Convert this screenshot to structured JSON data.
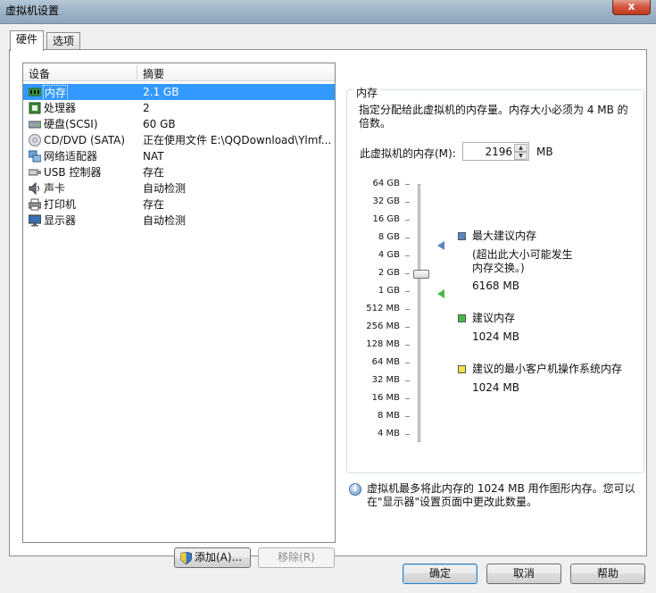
{
  "window": {
    "title": "虚拟机设置",
    "close_label": "x"
  },
  "tabs": [
    {
      "label": "硬件",
      "active": true
    },
    {
      "label": "选项",
      "active": false
    }
  ],
  "device_list": {
    "headers": {
      "device": "设备",
      "summary": "摘要"
    },
    "rows": [
      {
        "icon": "memory-icon",
        "name": "内存",
        "summary": "2.1 GB",
        "selected": true
      },
      {
        "icon": "processor-icon",
        "name": "处理器",
        "summary": "2"
      },
      {
        "icon": "hard-disk-icon",
        "name": "硬盘(SCSI)",
        "summary": "60 GB"
      },
      {
        "icon": "cd-dvd-icon",
        "name": "CD/DVD (SATA)",
        "summary": "正在使用文件 E:\\QQDownload\\Ylmf..."
      },
      {
        "icon": "network-adapter-icon",
        "name": "网络适配器",
        "summary": "NAT"
      },
      {
        "icon": "usb-icon",
        "name": "USB 控制器",
        "summary": "存在"
      },
      {
        "icon": "sound-card-icon",
        "name": "声卡",
        "summary": "自动检测"
      },
      {
        "icon": "printer-icon",
        "name": "打印机",
        "summary": "存在"
      },
      {
        "icon": "display-icon",
        "name": "显示器",
        "summary": "自动检测"
      }
    ],
    "add_button": "添加(A)...",
    "remove_button": "移除(R)"
  },
  "memory": {
    "group_title": "内存",
    "description": "指定分配给此虚拟机的内存量。内存大小必须为 4 MB 的倍数。",
    "field_label": "此虚拟机的内存(M):",
    "value": "2196",
    "unit": "MB",
    "scale_labels": [
      "64 GB",
      "32 GB",
      "16 GB",
      "8 GB",
      "4 GB",
      "2 GB",
      "1 GB",
      "512 MB",
      "256 MB",
      "128 MB",
      "64 MB",
      "32 MB",
      "16 MB",
      "8 MB",
      "4 MB"
    ],
    "slider_value_mb": 2196,
    "legend": {
      "max": {
        "label": "最大建议内存",
        "note": "(超出此大小可能发生内存交换。)",
        "value": "6168 MB",
        "color": "#5b86c4"
      },
      "recommended": {
        "label": "建议内存",
        "value": "1024 MB",
        "color": "#49b847"
      },
      "min": {
        "label": "建议的最小客户机操作系统内存",
        "value": "1024 MB",
        "color": "#f2e34a"
      }
    },
    "info_text": "虚拟机最多将此内存的 1024 MB 用作图形内存。您可以在\"显示器\"设置页面中更改此数量。"
  },
  "footer": {
    "ok": "确定",
    "cancel": "取消",
    "help": "帮助"
  }
}
